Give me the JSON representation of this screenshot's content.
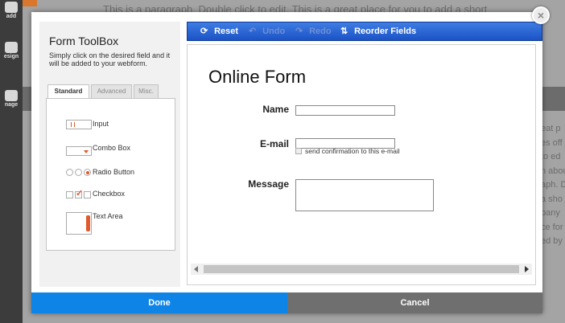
{
  "background": {
    "top_text": "This is a paragraph. Double click to edit. This is a great place for you to add a short",
    "left_tools": [
      {
        "label": "add"
      },
      {
        "label": "esign"
      },
      {
        "label": "nage"
      }
    ],
    "right_fragments": [
      "eat p",
      "es off",
      "to ed",
      "n abou",
      "aph. D",
      "a sho",
      "pany",
      "ce for",
      "ed by"
    ]
  },
  "dialog": {
    "close_label": "×",
    "toolbox": {
      "title": "Form ToolBox",
      "description": "Simply click on the desired field and it will be added to your webform.",
      "tabs": [
        {
          "label": "Standard",
          "active": true
        },
        {
          "label": "Advanced",
          "active": false
        },
        {
          "label": "Misc.",
          "active": false
        }
      ],
      "items": [
        {
          "label": "Input",
          "icon": "input-field-icon"
        },
        {
          "label": "Combo Box",
          "icon": "combo-box-icon"
        },
        {
          "label": "Radio Button",
          "icon": "radio-button-icon"
        },
        {
          "label": "Checkbox",
          "icon": "checkbox-icon"
        },
        {
          "label": "Text Area",
          "icon": "text-area-icon"
        }
      ]
    },
    "editor_toolbar": {
      "reset": "Reset",
      "undo": "Undo",
      "redo": "Redo",
      "reorder": "Reorder Fields"
    },
    "form": {
      "title": "Online Form",
      "fields": {
        "name_label": "Name",
        "name_value": "",
        "email_label": "E-mail",
        "email_value": "",
        "confirmation_text": "send confirmation to this e-mail",
        "message_label": "Message",
        "message_value": ""
      }
    },
    "buttons": {
      "done": "Done",
      "cancel": "Cancel"
    }
  },
  "colors": {
    "toolbar_blue": "#1b52c6",
    "done_blue": "#0f84e7",
    "cancel_grey": "#6f6f6f",
    "accent_orange": "#e05a2b"
  }
}
